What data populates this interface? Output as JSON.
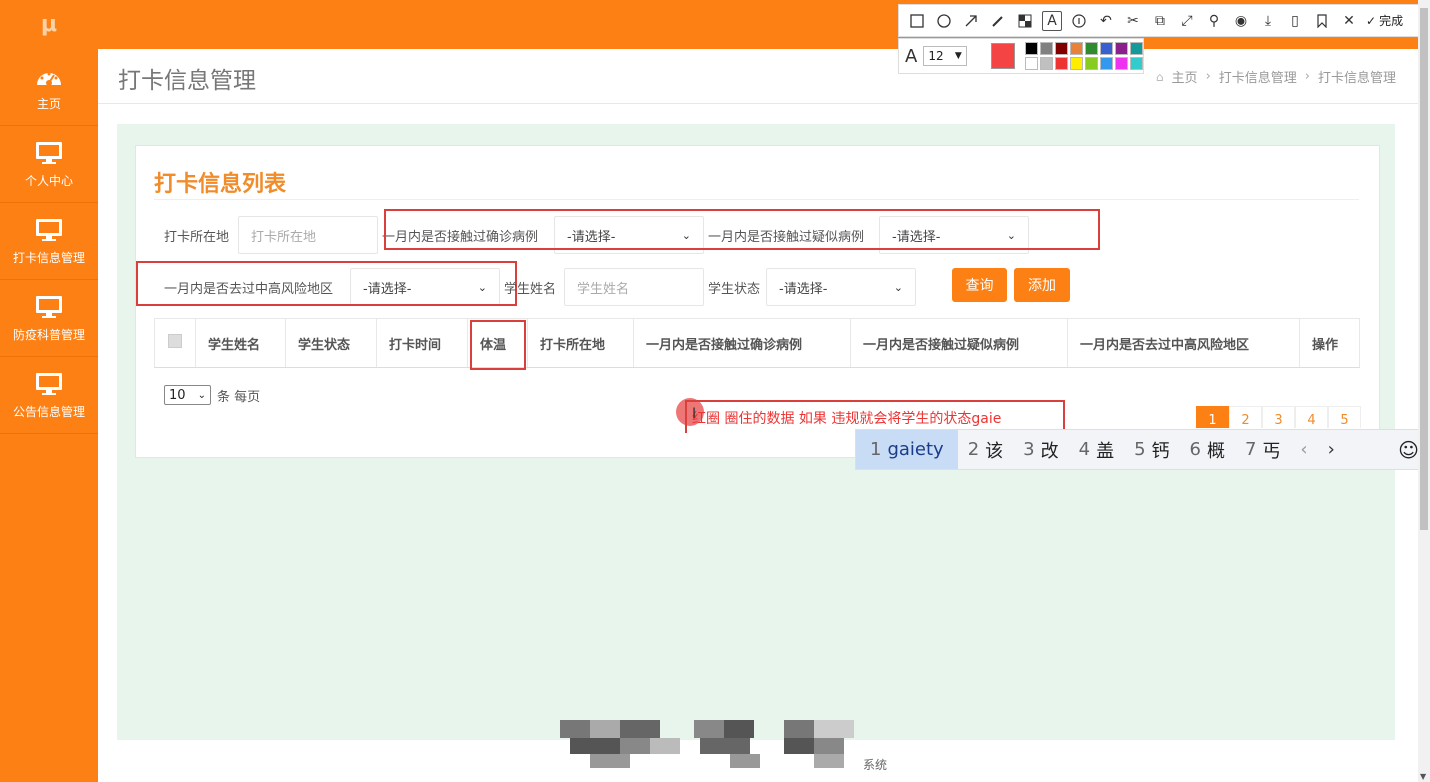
{
  "app": {
    "logo_text": "μ"
  },
  "sidebar": {
    "items": [
      {
        "label": "主页",
        "icon": "dashboard-icon"
      },
      {
        "label": "个人中心",
        "icon": "monitor-icon"
      },
      {
        "label": "打卡信息管理",
        "icon": "monitor-icon"
      },
      {
        "label": "防疫科普管理",
        "icon": "monitor-icon"
      },
      {
        "label": "公告信息管理",
        "icon": "monitor-icon"
      }
    ]
  },
  "header": {
    "title": "打卡信息管理",
    "breadcrumb": [
      "主页",
      "打卡信息管理",
      "打卡信息管理"
    ]
  },
  "card": {
    "title": "打卡信息列表"
  },
  "filters": {
    "location_label": "打卡所在地",
    "location_placeholder": "打卡所在地",
    "confirmed_label": "一月内是否接触过确诊病例",
    "confirmed_value": "-请选择-",
    "suspected_label": "一月内是否接触过疑似病例",
    "suspected_value": "-请选择-",
    "risk_label": "一月内是否去过中高风险地区",
    "risk_value": "-请选择-",
    "name_label": "学生姓名",
    "name_placeholder": "学生姓名",
    "status_label": "学生状态",
    "status_value": "-请选择-",
    "query_button": "查询",
    "add_button": "添加"
  },
  "table": {
    "columns": [
      "学生姓名",
      "学生状态",
      "打卡时间",
      "体温",
      "打卡所在地",
      "一月内是否接触过确诊病例",
      "一月内是否接触过疑似病例",
      "一月内是否去过中高风险地区",
      "操作"
    ]
  },
  "pagination": {
    "page_size": "10",
    "page_size_suffix": "条 每页",
    "pages": [
      "1",
      "2",
      "3",
      "4",
      "5"
    ],
    "current": "1"
  },
  "annotation": {
    "text": "红圈 圈住的数据 如果 违规就会将学生的状态gaie"
  },
  "ime": {
    "candidates": [
      {
        "n": "1",
        "t": "gaiety"
      },
      {
        "n": "2",
        "t": "该"
      },
      {
        "n": "3",
        "t": "改"
      },
      {
        "n": "4",
        "t": "盖"
      },
      {
        "n": "5",
        "t": "钙"
      },
      {
        "n": "6",
        "t": "概"
      },
      {
        "n": "7",
        "t": "丐"
      }
    ],
    "prev": "‹",
    "next": "›",
    "emoji": "☺"
  },
  "screenshot_toolbar": {
    "done_label": "完成",
    "font_size": "12",
    "current_color": "#f44444",
    "palette": [
      "#000000",
      "#808080",
      "#800000",
      "#e8823a",
      "#2e8b2e",
      "#3a5fd0",
      "#8b1f8b",
      "#159a9a",
      "#ffffff",
      "#c0c0c0",
      "#ee3333",
      "#ffee00",
      "#88cc22",
      "#3399ee",
      "#ee33ee",
      "#33cccc"
    ]
  },
  "footer": {
    "text": "系统"
  },
  "colors": {
    "brand": "#fd8014",
    "accent_title": "#f08c2a",
    "annotation_red": "#d9403c",
    "content_bg": "#e8f5ec"
  }
}
